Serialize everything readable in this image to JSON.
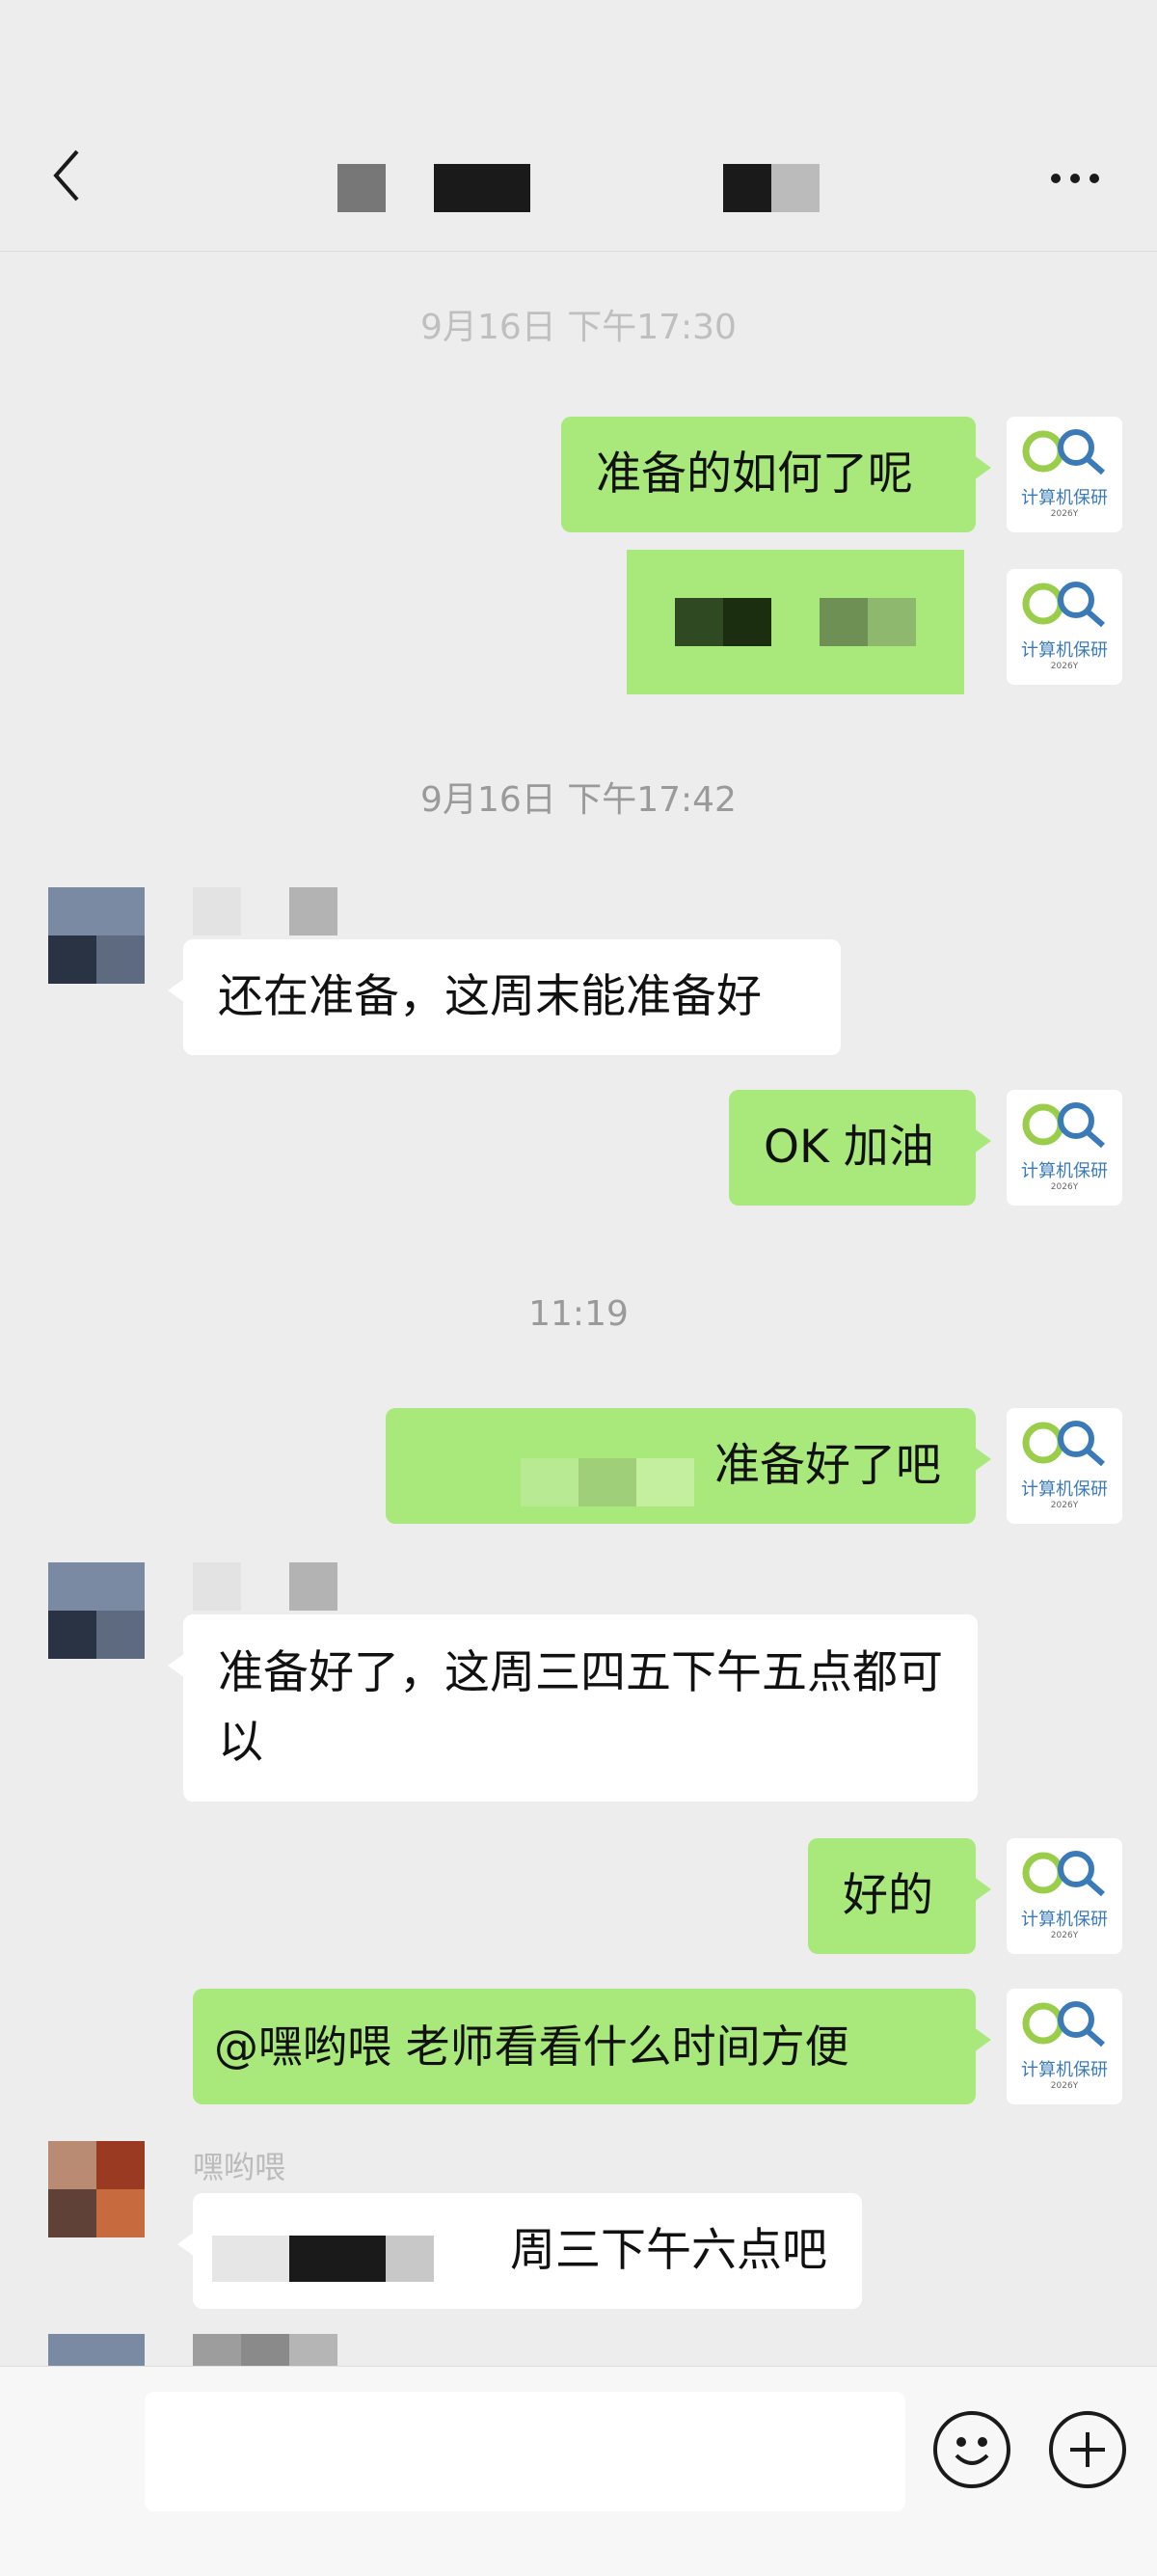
{
  "header": {
    "back_icon": "chevron-left-icon",
    "more_icon": "more-dots-icon"
  },
  "timestamps": [
    "9月16日 下午17:30",
    "9月16日 下午17:42",
    "11:19"
  ],
  "messages": [
    {
      "side": "out",
      "text": "准备的如何了呢"
    },
    {
      "side": "out",
      "text": ""
    },
    {
      "side": "in",
      "text": "还在准备，这周末能准备好"
    },
    {
      "side": "out",
      "text": "OK 加油"
    },
    {
      "side": "out",
      "text": "准备好了吧"
    },
    {
      "side": "in",
      "text": "准备好了，这周三四五下午五点都可以"
    },
    {
      "side": "out",
      "text": "好的"
    },
    {
      "side": "out",
      "text": "@嘿哟喂  老师看看什么时间方便"
    },
    {
      "side": "in",
      "sender": "嘿哟喂",
      "text": "周三下午六点吧"
    }
  ],
  "self_avatar": {
    "org": "计算机保研",
    "year": "2026Y"
  },
  "input": {
    "placeholder": ""
  },
  "toolbar": {
    "emoji_icon": "emoji-smile-icon",
    "plus_icon": "plus-circle-icon"
  },
  "colors": {
    "background": "#ededed",
    "outgoing_bubble": "#a9e97b",
    "incoming_bubble": "#ffffff",
    "timestamp": "#9a9a9a"
  }
}
